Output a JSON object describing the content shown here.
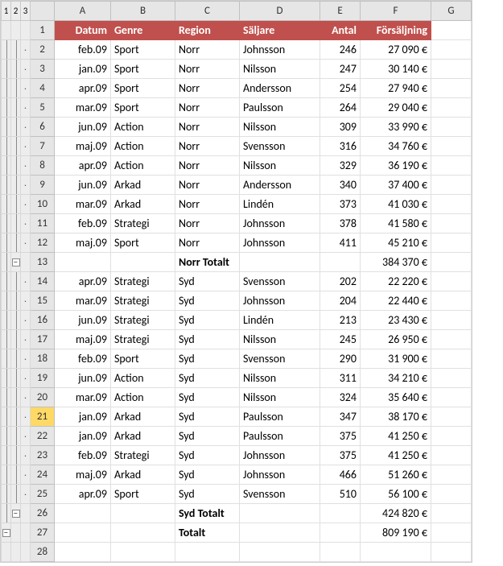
{
  "outline_levels": [
    "1",
    "2",
    "3"
  ],
  "col_headers": [
    "A",
    "B",
    "C",
    "D",
    "E",
    "F",
    "G"
  ],
  "field_headers": {
    "date": "Datum",
    "genre": "Genre",
    "region": "Region",
    "seller": "Säljare",
    "qty": "Antal",
    "sales": "Försäljning"
  },
  "rows": [
    {
      "n": 1,
      "type": "head"
    },
    {
      "n": 2,
      "type": "d",
      "date": "feb.09",
      "genre": "Sport",
      "region": "Norr",
      "seller": "Johnsson",
      "qty": "246",
      "sales": "27 090 €"
    },
    {
      "n": 3,
      "type": "d",
      "date": "jan.09",
      "genre": "Sport",
      "region": "Norr",
      "seller": "Nilsson",
      "qty": "247",
      "sales": "30 140 €"
    },
    {
      "n": 4,
      "type": "d",
      "date": "apr.09",
      "genre": "Sport",
      "region": "Norr",
      "seller": "Andersson",
      "qty": "254",
      "sales": "27 940 €"
    },
    {
      "n": 5,
      "type": "d",
      "date": "mar.09",
      "genre": "Sport",
      "region": "Norr",
      "seller": "Paulsson",
      "qty": "264",
      "sales": "29 040 €"
    },
    {
      "n": 6,
      "type": "d",
      "date": "jun.09",
      "genre": "Action",
      "region": "Norr",
      "seller": "Nilsson",
      "qty": "309",
      "sales": "33 990 €"
    },
    {
      "n": 7,
      "type": "d",
      "date": "maj.09",
      "genre": "Action",
      "region": "Norr",
      "seller": "Svensson",
      "qty": "316",
      "sales": "34 760 €"
    },
    {
      "n": 8,
      "type": "d",
      "date": "apr.09",
      "genre": "Action",
      "region": "Norr",
      "seller": "Nilsson",
      "qty": "329",
      "sales": "36 190 €"
    },
    {
      "n": 9,
      "type": "d",
      "date": "jun.09",
      "genre": "Arkad",
      "region": "Norr",
      "seller": "Andersson",
      "qty": "340",
      "sales": "37 400 €"
    },
    {
      "n": 10,
      "type": "d",
      "date": "mar.09",
      "genre": "Arkad",
      "region": "Norr",
      "seller": "Lindén",
      "qty": "373",
      "sales": "41 030 €"
    },
    {
      "n": 11,
      "type": "d",
      "date": "feb.09",
      "genre": "Strategi",
      "region": "Norr",
      "seller": "Johnsson",
      "qty": "378",
      "sales": "41 580 €"
    },
    {
      "n": 12,
      "type": "d",
      "date": "maj.09",
      "genre": "Sport",
      "region": "Norr",
      "seller": "Johnsson",
      "qty": "411",
      "sales": "45 210 €"
    },
    {
      "n": 13,
      "type": "sub",
      "label": "Norr Totalt",
      "sales": "384 370 €"
    },
    {
      "n": 14,
      "type": "d",
      "date": "apr.09",
      "genre": "Strategi",
      "region": "Syd",
      "seller": "Svensson",
      "qty": "202",
      "sales": "22 220 €"
    },
    {
      "n": 15,
      "type": "d",
      "date": "mar.09",
      "genre": "Strategi",
      "region": "Syd",
      "seller": "Johnsson",
      "qty": "204",
      "sales": "22 440 €"
    },
    {
      "n": 16,
      "type": "d",
      "date": "jun.09",
      "genre": "Strategi",
      "region": "Syd",
      "seller": "Lindén",
      "qty": "213",
      "sales": "23 430 €"
    },
    {
      "n": 17,
      "type": "d",
      "date": "maj.09",
      "genre": "Strategi",
      "region": "Syd",
      "seller": "Nilsson",
      "qty": "245",
      "sales": "26 950 €"
    },
    {
      "n": 18,
      "type": "d",
      "date": "feb.09",
      "genre": "Sport",
      "region": "Syd",
      "seller": "Svensson",
      "qty": "290",
      "sales": "31 900 €"
    },
    {
      "n": 19,
      "type": "d",
      "date": "jun.09",
      "genre": "Action",
      "region": "Syd",
      "seller": "Nilsson",
      "qty": "311",
      "sales": "34 210 €"
    },
    {
      "n": 20,
      "type": "d",
      "date": "mar.09",
      "genre": "Action",
      "region": "Syd",
      "seller": "Nilsson",
      "qty": "324",
      "sales": "35 640 €"
    },
    {
      "n": 21,
      "type": "d",
      "date": "jan.09",
      "genre": "Arkad",
      "region": "Syd",
      "seller": "Paulsson",
      "qty": "347",
      "sales": "38 170 €",
      "sel": true
    },
    {
      "n": 22,
      "type": "d",
      "date": "jan.09",
      "genre": "Arkad",
      "region": "Syd",
      "seller": "Paulsson",
      "qty": "375",
      "sales": "41 250 €"
    },
    {
      "n": 23,
      "type": "d",
      "date": "feb.09",
      "genre": "Strategi",
      "region": "Syd",
      "seller": "Johnsson",
      "qty": "375",
      "sales": "41 250 €"
    },
    {
      "n": 24,
      "type": "d",
      "date": "maj.09",
      "genre": "Arkad",
      "region": "Syd",
      "seller": "Johnsson",
      "qty": "466",
      "sales": "51 260 €"
    },
    {
      "n": 25,
      "type": "d",
      "date": "apr.09",
      "genre": "Sport",
      "region": "Syd",
      "seller": "Svensson",
      "qty": "510",
      "sales": "56 100 €"
    },
    {
      "n": 26,
      "type": "sub",
      "label": "Syd Totalt",
      "sales": "424 820 €"
    },
    {
      "n": 27,
      "type": "tot",
      "label": "Totalt",
      "sales": "809 190 €"
    },
    {
      "n": 28,
      "type": "blank"
    }
  ],
  "colw": {
    "outline": 12,
    "rownum": 30,
    "A": 70,
    "B": 80,
    "C": 80,
    "D": 100,
    "E": 50,
    "F": 88,
    "G": 50
  }
}
